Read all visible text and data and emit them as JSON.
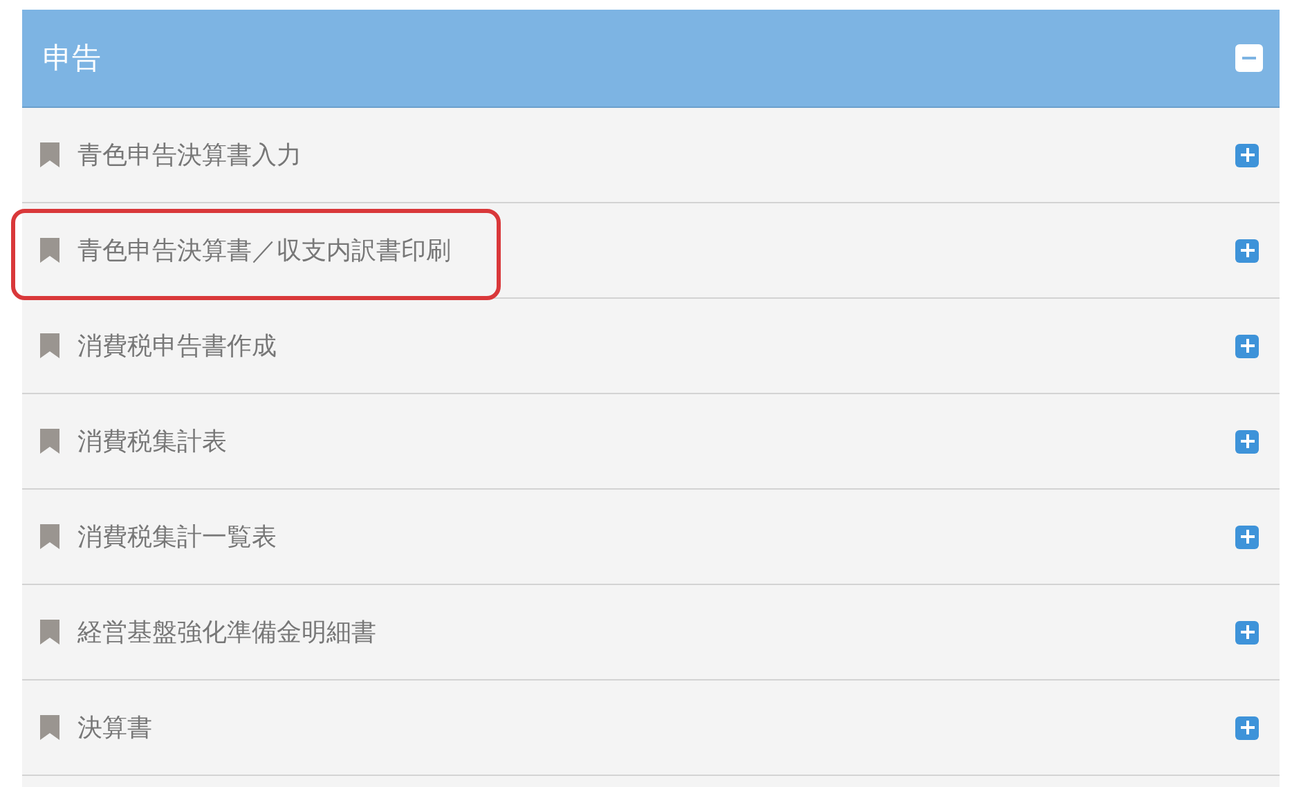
{
  "panel": {
    "title": "申告",
    "expanded": true,
    "items": [
      {
        "label": "青色申告決算書入力",
        "expanded": false,
        "highlighted": false
      },
      {
        "label": "青色申告決算書／収支内訳書印刷",
        "expanded": false,
        "highlighted": true
      },
      {
        "label": "消費税申告書作成",
        "expanded": false,
        "highlighted": false
      },
      {
        "label": "消費税集計表",
        "expanded": false,
        "highlighted": false
      },
      {
        "label": "消費税集計一覧表",
        "expanded": false,
        "highlighted": false
      },
      {
        "label": "経営基盤強化準備金明細書",
        "expanded": false,
        "highlighted": false
      },
      {
        "label": "決算書",
        "expanded": false,
        "highlighted": false
      }
    ]
  }
}
